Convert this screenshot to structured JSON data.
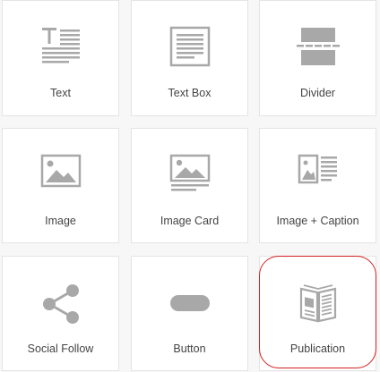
{
  "tiles": [
    {
      "label": "Text",
      "icon": "text-icon"
    },
    {
      "label": "Text Box",
      "icon": "text-box-icon"
    },
    {
      "label": "Divider",
      "icon": "divider-icon"
    },
    {
      "label": "Image",
      "icon": "image-icon"
    },
    {
      "label": "Image Card",
      "icon": "image-card-icon"
    },
    {
      "label": "Image + Caption",
      "icon": "image-caption-icon"
    },
    {
      "label": "Social Follow",
      "icon": "share-icon"
    },
    {
      "label": "Button",
      "icon": "button-icon"
    },
    {
      "label": "Publication",
      "icon": "publication-icon"
    }
  ],
  "selected": "Publication",
  "colors": {
    "icon": "#a8a8a8",
    "highlight": "#d42020",
    "label": "#444444",
    "tile_border": "#e4e4e4"
  }
}
